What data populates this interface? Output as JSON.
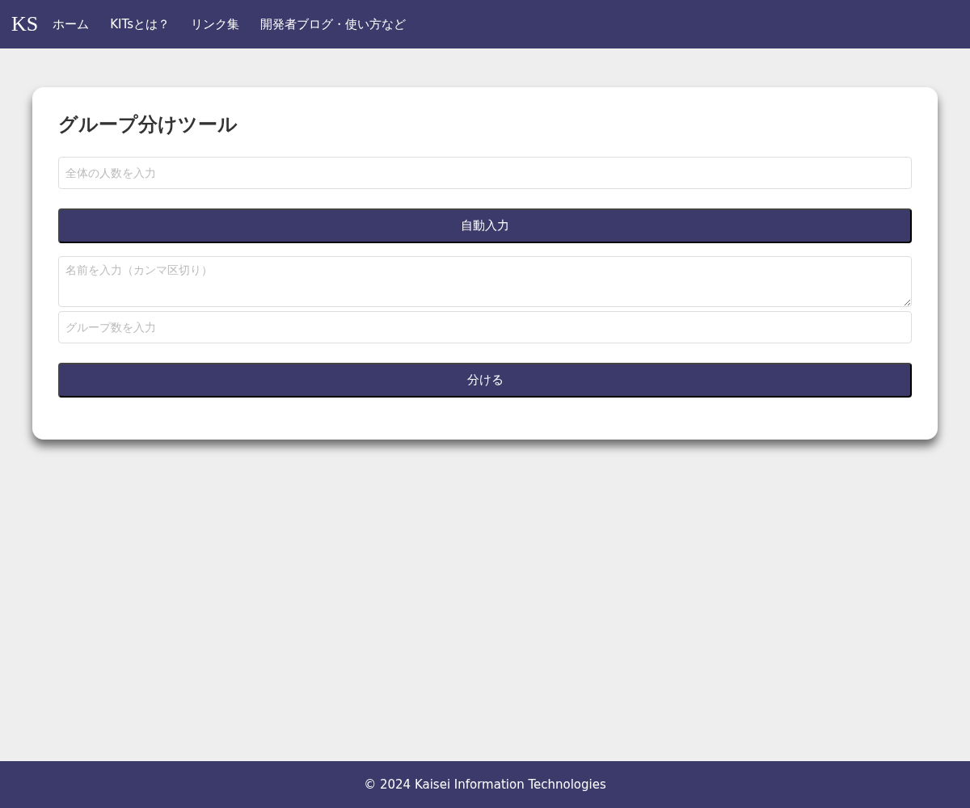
{
  "header": {
    "logo": "KS",
    "nav": [
      {
        "label": "ホーム"
      },
      {
        "label": "KITsとは？"
      },
      {
        "label": "リンク集"
      },
      {
        "label": "開発者ブログ・使い方など"
      }
    ]
  },
  "tool": {
    "title": "グループ分けツール",
    "fields": [
      {
        "kind": "input",
        "placeholder": "全体の人数を入力"
      },
      {
        "kind": "button",
        "label": "自動入力"
      },
      {
        "kind": "textarea",
        "placeholder": "名前を入力（カンマ区切り）"
      },
      {
        "kind": "input",
        "placeholder": "グループ数を入力"
      },
      {
        "kind": "button",
        "label": "分ける"
      }
    ]
  },
  "footer": {
    "text": "© 2024 Kaisei Information Technologies"
  }
}
